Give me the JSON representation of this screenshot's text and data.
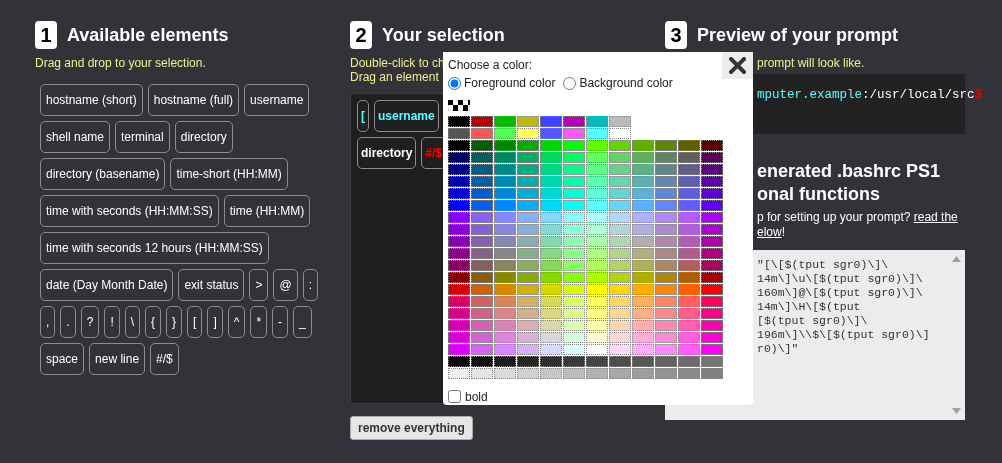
{
  "available": {
    "number": "1",
    "title": "Available elements",
    "hint": "Drag and drop to your selection.",
    "elements": [
      "hostname (short)",
      "hostname (full)",
      "username",
      "shell name",
      "terminal",
      "directory",
      "directory (basename)",
      "time-short (HH:MM)",
      "time with seconds (HH:MM:SS)",
      "time (HH:MM)",
      "time with seconds 12 hours (HH:MM:SS)",
      "date (Day Month Date)",
      "exit status",
      ">",
      "@",
      ":",
      ",",
      ".",
      "?",
      "!",
      "\\",
      "{",
      "}",
      "[",
      "]",
      "^",
      "*",
      "-",
      "_",
      "space",
      "new line",
      "#/$"
    ]
  },
  "selection": {
    "number": "2",
    "title": "Your selection",
    "hints": [
      "Double-click to ch",
      "Drag an element"
    ],
    "rows": [
      [
        {
          "label": "[",
          "color": "#55ffff"
        },
        {
          "label": "username",
          "color": "#55ffff"
        }
      ],
      [
        {
          "label": "directory",
          "color": "#ffffff"
        },
        {
          "label": "#/$",
          "color": "#ff0000"
        }
      ]
    ],
    "remove_button": "remove everything"
  },
  "preview": {
    "number": "3",
    "title": "Preview of your prompt",
    "hint": "prompt will look like.",
    "terminal": [
      {
        "text": "mputer.example",
        "color": "#55ffff"
      },
      {
        "text": ":/usr/local/src",
        "color": "#ffffff"
      },
      {
        "text": "$",
        "color": "#ff0000"
      }
    ]
  },
  "generated": {
    "title_lines": [
      "enerated .bashrc PS1",
      "onal functions"
    ],
    "help_lines": [
      {
        "text": "p for setting up your prompt? ",
        "link": "read the"
      },
      {
        "link": "elow",
        "after": "!"
      }
    ],
    "code_lines": [
      "\"[\\[$(tput sgr0)\\]\\",
      "14m\\]\\u\\[$(tput sgr0)\\]\\",
      "160m\\]@\\[$(tput sgr0)\\]\\",
      "14m\\]\\H\\[$(tput",
      "[$(tput sgr0)\\]\\",
      "196m\\]\\\\$\\[$(tput sgr0)\\]",
      "r0)\\]\""
    ]
  },
  "color_picker": {
    "prompt": "Choose a color:",
    "targets": [
      {
        "label": "Foreground color",
        "selected": true
      },
      {
        "label": "Background color",
        "selected": false
      }
    ],
    "basic_rows": [
      [
        {
          "color": "#000000"
        },
        {
          "color": "#bb0000"
        },
        {
          "color": "#00bb00"
        },
        {
          "color": "#bbbb00"
        },
        {
          "color": "#4040ff"
        },
        {
          "color": "#bb00bb"
        },
        {
          "color": "#00bbbb"
        },
        {
          "color": "#bbbbbb"
        }
      ],
      [
        {
          "color": "#555555"
        },
        {
          "color": "#ff5555"
        },
        {
          "color": "#55ff55"
        },
        {
          "color": "#ffff55"
        },
        {
          "color": "#5555ff"
        },
        {
          "color": "#ff55ff"
        },
        {
          "color": "#55ffff"
        },
        {
          "color": "#ffffff"
        }
      ]
    ],
    "palette_rows": [
      [
        {
          "color": "#000000"
        },
        {
          "color": "#005f00"
        },
        {
          "color": "#008700"
        },
        {
          "color": "#00af00"
        },
        {
          "color": "#00d700"
        },
        {
          "color": "#00ff00"
        },
        {
          "color": "#5fff00"
        },
        {
          "color": "#5fd700"
        },
        {
          "color": "#5faf00"
        },
        {
          "color": "#5f8700"
        },
        {
          "color": "#5f5f00"
        },
        {
          "color": "#5f0000"
        }
      ],
      [
        {
          "color": "#00005f"
        },
        {
          "color": "#005f5f"
        },
        {
          "color": "#00875f"
        },
        {
          "color": "#00af5f"
        },
        {
          "color": "#00d75f"
        },
        {
          "color": "#00ff5f"
        },
        {
          "color": "#5fff5f"
        },
        {
          "color": "#5fd75f"
        },
        {
          "color": "#5faf5f"
        },
        {
          "color": "#5f875f"
        },
        {
          "color": "#5f5f5f"
        },
        {
          "color": "#5f005f"
        }
      ],
      [
        {
          "color": "#000087"
        },
        {
          "color": "#005f87"
        },
        {
          "color": "#008787"
        },
        {
          "color": "#00af87"
        },
        {
          "color": "#00d787"
        },
        {
          "color": "#00ff87"
        },
        {
          "color": "#5fff87"
        },
        {
          "color": "#5fd787"
        },
        {
          "color": "#5faf87"
        },
        {
          "color": "#5f8787"
        },
        {
          "color": "#5f5f87"
        },
        {
          "color": "#5f0087"
        }
      ],
      [
        {
          "color": "#0000af"
        },
        {
          "color": "#005faf"
        },
        {
          "color": "#0087af"
        },
        {
          "color": "#00afaf"
        },
        {
          "color": "#00d7af"
        },
        {
          "color": "#00ffaf"
        },
        {
          "color": "#5fffaf"
        },
        {
          "color": "#5fd7af"
        },
        {
          "color": "#5fafaf"
        },
        {
          "color": "#5f87af"
        },
        {
          "color": "#5f5faf"
        },
        {
          "color": "#5f00af"
        }
      ],
      [
        {
          "color": "#0000d7"
        },
        {
          "color": "#005fd7"
        },
        {
          "color": "#0087d7"
        },
        {
          "color": "#00afd7"
        },
        {
          "color": "#00d7d7"
        },
        {
          "color": "#00ffd7"
        },
        {
          "color": "#5fffd7"
        },
        {
          "color": "#5fd7d7"
        },
        {
          "color": "#5fafd7"
        },
        {
          "color": "#5f87d7"
        },
        {
          "color": "#5f5fd7"
        },
        {
          "color": "#5f00d7"
        }
      ],
      [
        {
          "color": "#0000ff"
        },
        {
          "color": "#005fff"
        },
        {
          "color": "#0087ff"
        },
        {
          "color": "#00afff"
        },
        {
          "color": "#00d7ff"
        },
        {
          "color": "#00ffff"
        },
        {
          "color": "#5fffff"
        },
        {
          "color": "#5fd7ff"
        },
        {
          "color": "#5fafff"
        },
        {
          "color": "#5f87ff"
        },
        {
          "color": "#5f5fff"
        },
        {
          "color": "#5f00ff"
        }
      ],
      [
        {
          "color": "#8700ff"
        },
        {
          "color": "#875fff"
        },
        {
          "color": "#8787ff"
        },
        {
          "color": "#87afff"
        },
        {
          "color": "#87d7ff"
        },
        {
          "color": "#87ffff"
        },
        {
          "color": "#afffff"
        },
        {
          "color": "#afd7ff"
        },
        {
          "color": "#afafff"
        },
        {
          "color": "#af87ff"
        },
        {
          "color": "#af5fff"
        },
        {
          "color": "#af00ff"
        }
      ],
      [
        {
          "color": "#8700d7"
        },
        {
          "color": "#875fd7"
        },
        {
          "color": "#8787d7"
        },
        {
          "color": "#87afd7"
        },
        {
          "color": "#87d7d7"
        },
        {
          "color": "#87ffd7"
        },
        {
          "color": "#afffd7"
        },
        {
          "color": "#afd7d7"
        },
        {
          "color": "#afafd7"
        },
        {
          "color": "#af87d7"
        },
        {
          "color": "#af5fd7"
        },
        {
          "color": "#af00d7"
        }
      ],
      [
        {
          "color": "#8700af"
        },
        {
          "color": "#875faf"
        },
        {
          "color": "#8787af"
        },
        {
          "color": "#87afaf"
        },
        {
          "color": "#87d7af"
        },
        {
          "color": "#87ffaf"
        },
        {
          "color": "#afffaf"
        },
        {
          "color": "#afd7af"
        },
        {
          "color": "#afafaf"
        },
        {
          "color": "#af87af"
        },
        {
          "color": "#af5faf"
        },
        {
          "color": "#af00af"
        }
      ],
      [
        {
          "color": "#870087"
        },
        {
          "color": "#875f87"
        },
        {
          "color": "#878787"
        },
        {
          "color": "#87af87"
        },
        {
          "color": "#87d787"
        },
        {
          "color": "#87ff87"
        },
        {
          "color": "#afff87"
        },
        {
          "color": "#afd787"
        },
        {
          "color": "#afaf87"
        },
        {
          "color": "#af8787"
        },
        {
          "color": "#af5f87"
        },
        {
          "color": "#af0087"
        }
      ],
      [
        {
          "color": "#87005f"
        },
        {
          "color": "#875f5f"
        },
        {
          "color": "#87875f"
        },
        {
          "color": "#87af5f"
        },
        {
          "color": "#87d75f"
        },
        {
          "color": "#87ff5f"
        },
        {
          "color": "#afff5f"
        },
        {
          "color": "#afd75f"
        },
        {
          "color": "#afaf5f"
        },
        {
          "color": "#af875f"
        },
        {
          "color": "#af5f5f"
        },
        {
          "color": "#af005f"
        }
      ],
      [
        {
          "color": "#870000"
        },
        {
          "color": "#875f00"
        },
        {
          "color": "#878700"
        },
        {
          "color": "#87af00"
        },
        {
          "color": "#87d700"
        },
        {
          "color": "#87ff00"
        },
        {
          "color": "#afff00"
        },
        {
          "color": "#afd700"
        },
        {
          "color": "#afaf00"
        },
        {
          "color": "#af8700"
        },
        {
          "color": "#af5f00"
        },
        {
          "color": "#af0000"
        }
      ],
      [
        {
          "color": "#d70000"
        },
        {
          "color": "#d75f00"
        },
        {
          "color": "#d78700"
        },
        {
          "color": "#d7af00"
        },
        {
          "color": "#d7d700"
        },
        {
          "color": "#d7ff00"
        },
        {
          "color": "#ffff00"
        },
        {
          "color": "#ffd700"
        },
        {
          "color": "#ffaf00"
        },
        {
          "color": "#ff8700"
        },
        {
          "color": "#ff5f00"
        },
        {
          "color": "#ff0000"
        }
      ],
      [
        {
          "color": "#d7005f"
        },
        {
          "color": "#d75f5f"
        },
        {
          "color": "#d7875f"
        },
        {
          "color": "#d7af5f"
        },
        {
          "color": "#d7d75f"
        },
        {
          "color": "#d7ff5f"
        },
        {
          "color": "#ffff5f"
        },
        {
          "color": "#ffd75f"
        },
        {
          "color": "#ffaf5f"
        },
        {
          "color": "#ff875f"
        },
        {
          "color": "#ff5f5f"
        },
        {
          "color": "#ff005f"
        }
      ],
      [
        {
          "color": "#d70087"
        },
        {
          "color": "#d75f87"
        },
        {
          "color": "#d78787"
        },
        {
          "color": "#d7af87"
        },
        {
          "color": "#d7d787"
        },
        {
          "color": "#d7ff87"
        },
        {
          "color": "#ffff87"
        },
        {
          "color": "#ffd787"
        },
        {
          "color": "#ffaf87"
        },
        {
          "color": "#ff8787"
        },
        {
          "color": "#ff5f87"
        },
        {
          "color": "#ff0087"
        }
      ],
      [
        {
          "color": "#d700af"
        },
        {
          "color": "#d75faf"
        },
        {
          "color": "#d787af"
        },
        {
          "color": "#d7afaf"
        },
        {
          "color": "#d7d7af"
        },
        {
          "color": "#d7ffaf"
        },
        {
          "color": "#ffffaf"
        },
        {
          "color": "#ffd7af"
        },
        {
          "color": "#ffafaf"
        },
        {
          "color": "#ff87af"
        },
        {
          "color": "#ff5faf"
        },
        {
          "color": "#ff00af"
        }
      ],
      [
        {
          "color": "#d700d7"
        },
        {
          "color": "#d75fd7"
        },
        {
          "color": "#d787d7"
        },
        {
          "color": "#d7afd7"
        },
        {
          "color": "#d7d7d7"
        },
        {
          "color": "#d7ffd7"
        },
        {
          "color": "#ffffd7"
        },
        {
          "color": "#ffd7d7"
        },
        {
          "color": "#ffafd7"
        },
        {
          "color": "#ff87d7"
        },
        {
          "color": "#ff5fd7"
        },
        {
          "color": "#ff00d7"
        }
      ],
      [
        {
          "color": "#d700ff"
        },
        {
          "color": "#d75fff"
        },
        {
          "color": "#d787ff"
        },
        {
          "color": "#d7afff"
        },
        {
          "color": "#d7d7ff"
        },
        {
          "color": "#d7ffff"
        },
        {
          "color": "#ffffff"
        },
        {
          "color": "#ffd7ff"
        },
        {
          "color": "#ffafff"
        },
        {
          "color": "#ff87ff"
        },
        {
          "color": "#ff5fff"
        },
        {
          "color": "#ff00ff"
        }
      ]
    ],
    "gray_rows": [
      [
        {
          "color": "#080808"
        },
        {
          "color": "#121212"
        },
        {
          "color": "#1c1c1c"
        },
        {
          "color": "#262626"
        },
        {
          "color": "#303030"
        },
        {
          "color": "#3a3a3a"
        },
        {
          "color": "#444444"
        },
        {
          "color": "#4e4e4e"
        },
        {
          "color": "#585858"
        },
        {
          "color": "#626262"
        },
        {
          "color": "#6c6c6c"
        },
        {
          "color": "#767676"
        }
      ],
      [
        {
          "color": "#eeeeee"
        },
        {
          "color": "#e4e4e4"
        },
        {
          "color": "#dadada"
        },
        {
          "color": "#d0d0d0"
        },
        {
          "color": "#c6c6c6"
        },
        {
          "color": "#bcbcbc"
        },
        {
          "color": "#b2b2b2"
        },
        {
          "color": "#a8a8a8"
        },
        {
          "color": "#9e9e9e"
        },
        {
          "color": "#949494"
        },
        {
          "color": "#8a8a8a"
        },
        {
          "color": "#808080"
        }
      ]
    ],
    "bold": {
      "label": "bold",
      "checked": false
    }
  }
}
